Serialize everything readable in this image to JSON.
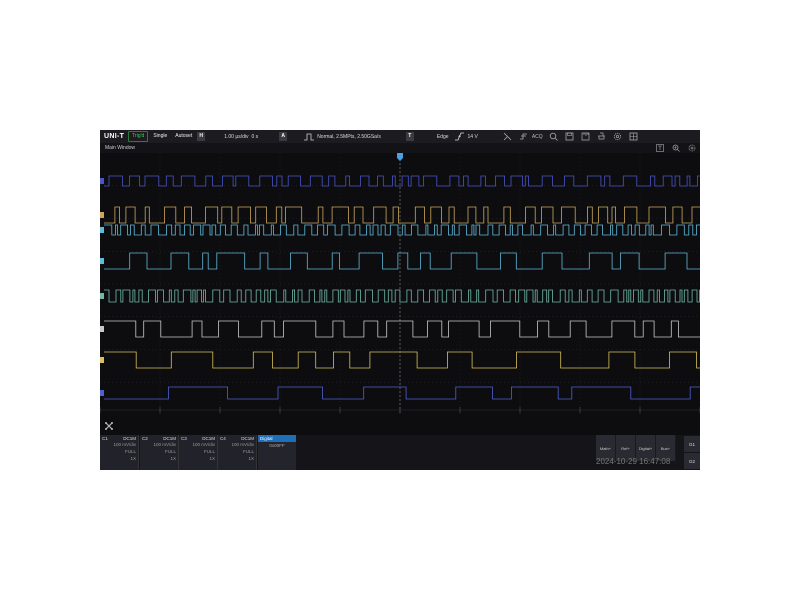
{
  "app": {
    "brand": "UNI-T",
    "window_title": "Main Window"
  },
  "toolbar": {
    "trig_label": "Trig'd",
    "single_label": "Single",
    "autoset_label": "Autoset",
    "h_badge": "H",
    "timebase": "1.00 µs/div",
    "h_offset": "0 s",
    "a_badge": "A",
    "acq_mode": "Normal,  2.5MPts,  2.50GSa/s",
    "t_badge": "T",
    "trigger_type": "Edge",
    "trigger_level": "14 V",
    "acq_label": "ACQ"
  },
  "icons": {
    "edge": "rising-edge-icon",
    "cursor": "cursor-icon",
    "search": "search-icon",
    "save": "save-icon",
    "measure": "measure-icon",
    "ruler": "ruler-icon",
    "settings": "gear-icon",
    "layout": "layout-icon",
    "clear": "clear-icon"
  },
  "colors": {
    "ch1": "#4a55c8",
    "ch2": "#c9a85a",
    "ch3": "#5fb9d9",
    "ch4": "#5fb9d9",
    "ch5": "#6fb8a8",
    "ch6": "#c8c8c8",
    "ch7": "#d8c05a",
    "ch8": "#5060d0",
    "digital_accent": "#1e6fb8"
  },
  "channels": [
    {
      "name": "C1",
      "coupling": "DC1M",
      "scale": "100 mV/div",
      "bw": "FULL",
      "probe": "1X"
    },
    {
      "name": "C2",
      "coupling": "DC1M",
      "scale": "100 mV/div",
      "bw": "FULL",
      "probe": "1X"
    },
    {
      "name": "C3",
      "coupling": "DC1M",
      "scale": "100 mV/div",
      "bw": "FULL",
      "probe": "1X"
    },
    {
      "name": "C4",
      "coupling": "DC1M",
      "scale": "100 mV/div",
      "bw": "FULL",
      "probe": "1X"
    }
  ],
  "digital": {
    "label": "Digital",
    "value": "0x00FF"
  },
  "function_buttons": {
    "math": "Math+",
    "ref": "Ref+",
    "digital": "Digital+",
    "bus": "Bus+"
  },
  "group_buttons": {
    "g1": "G1",
    "g2": "G2"
  },
  "datetime": "2024-10-29 16:47:08"
}
